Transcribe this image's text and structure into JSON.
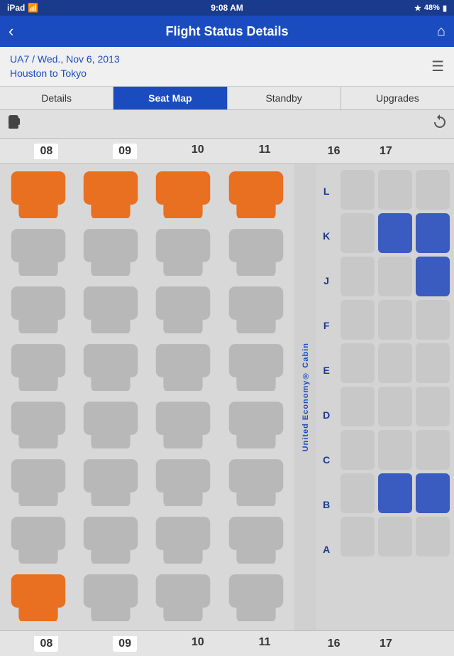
{
  "statusBar": {
    "left": "iPad",
    "time": "9:08 AM",
    "right": "48%",
    "wifiIcon": "wifi",
    "batteryIcon": "battery",
    "bluetoothIcon": "bt"
  },
  "navBar": {
    "title": "Flight Status Details",
    "backLabel": "‹",
    "homeIcon": "⌂"
  },
  "flightInfo": {
    "line1": "UA7 / Wed., Nov 6, 2013",
    "line2": "Houston to Tokyo"
  },
  "tabs": [
    {
      "id": "details",
      "label": "Details",
      "active": false
    },
    {
      "id": "seatmap",
      "label": "Seat Map",
      "active": true
    },
    {
      "id": "standby",
      "label": "Standby",
      "active": false
    },
    {
      "id": "upgrades",
      "label": "Upgrades",
      "active": false
    }
  ],
  "seatMap": {
    "topColumns": [
      "08",
      "09",
      "10",
      "11",
      "16",
      "17"
    ],
    "bottomColumns": [
      "08",
      "09",
      "10",
      "11",
      "16",
      "17"
    ],
    "rowLabels": [
      "L",
      "K",
      "J",
      "F",
      "E",
      "D",
      "C",
      "B",
      "A"
    ],
    "cabinLabel": "United Economy® Cabin",
    "businessSeats": {
      "row1": [
        "orange",
        "orange",
        "orange",
        "orange"
      ],
      "row2": [
        "gray",
        "gray",
        "gray",
        "gray"
      ],
      "row3": [
        "gray",
        "gray",
        "gray",
        "gray"
      ],
      "row4": [
        "gray",
        "gray",
        "gray",
        "gray"
      ],
      "row5": [
        "gray",
        "gray",
        "gray",
        "gray"
      ],
      "row6": [
        "gray",
        "gray",
        "gray",
        "gray"
      ],
      "row7": [
        "gray",
        "gray",
        "gray",
        "gray"
      ],
      "row8": [
        "orange",
        "gray",
        "gray",
        "gray"
      ]
    },
    "economySeats": {
      "L": [
        "avail",
        "avail",
        "avail"
      ],
      "K": [
        "avail",
        "taken",
        "taken"
      ],
      "J": [
        "avail",
        "avail",
        "taken"
      ],
      "F": [
        "avail",
        "avail",
        "avail"
      ],
      "E": [
        "avail",
        "avail",
        "avail"
      ],
      "D": [
        "avail",
        "avail",
        "avail"
      ],
      "C": [
        "avail",
        "avail",
        "avail"
      ],
      "B": [
        "avail",
        "taken",
        "taken"
      ],
      "A": [
        "avail",
        "avail",
        "avail"
      ]
    }
  }
}
